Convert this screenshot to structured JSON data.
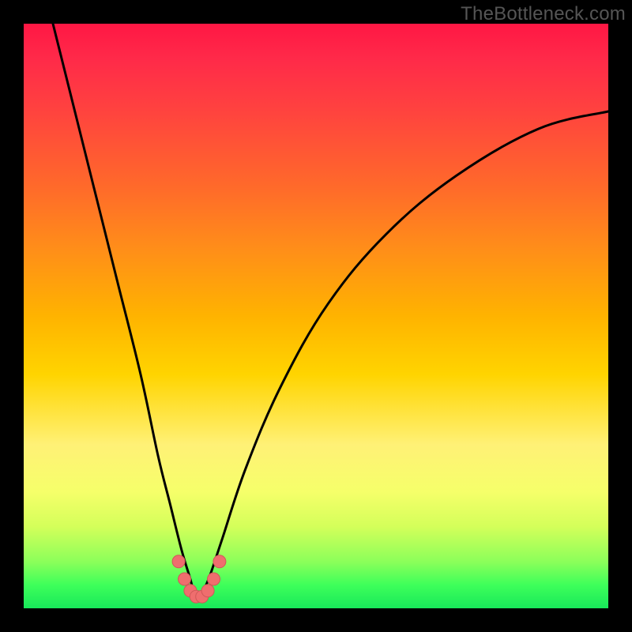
{
  "watermark": "TheBottleneck.com",
  "colors": {
    "page_bg": "#000000",
    "curve": "#000000",
    "dots": "#ef6e6e"
  },
  "chart_data": {
    "type": "line",
    "title": "",
    "xlabel": "",
    "ylabel": "",
    "xlim": [
      0,
      100
    ],
    "ylim": [
      0,
      100
    ],
    "series": [
      {
        "name": "bottleneck-curve",
        "x": [
          5,
          8,
          12,
          16,
          20,
          23,
          25,
          27,
          28.5,
          29,
          29.5,
          30,
          30.5,
          31,
          32,
          34,
          38,
          44,
          52,
          62,
          74,
          88,
          100
        ],
        "y": [
          100,
          88,
          72,
          56,
          40,
          26,
          18,
          10,
          5,
          3,
          2,
          1.5,
          2,
          3.5,
          6,
          12,
          24,
          38,
          52,
          64,
          74,
          82,
          85
        ]
      }
    ],
    "markers": [
      {
        "x": 26.5,
        "y": 8
      },
      {
        "x": 27.5,
        "y": 5
      },
      {
        "x": 28.5,
        "y": 3
      },
      {
        "x": 29.5,
        "y": 2
      },
      {
        "x": 30.5,
        "y": 2
      },
      {
        "x": 31.5,
        "y": 3
      },
      {
        "x": 32.5,
        "y": 5
      },
      {
        "x": 33.5,
        "y": 8
      }
    ],
    "background_gradient": [
      {
        "stop": 0,
        "color": "#ff1744"
      },
      {
        "stop": 50,
        "color": "#ffb300"
      },
      {
        "stop": 75,
        "color": "#fff176"
      },
      {
        "stop": 100,
        "color": "#18e85a"
      }
    ]
  }
}
